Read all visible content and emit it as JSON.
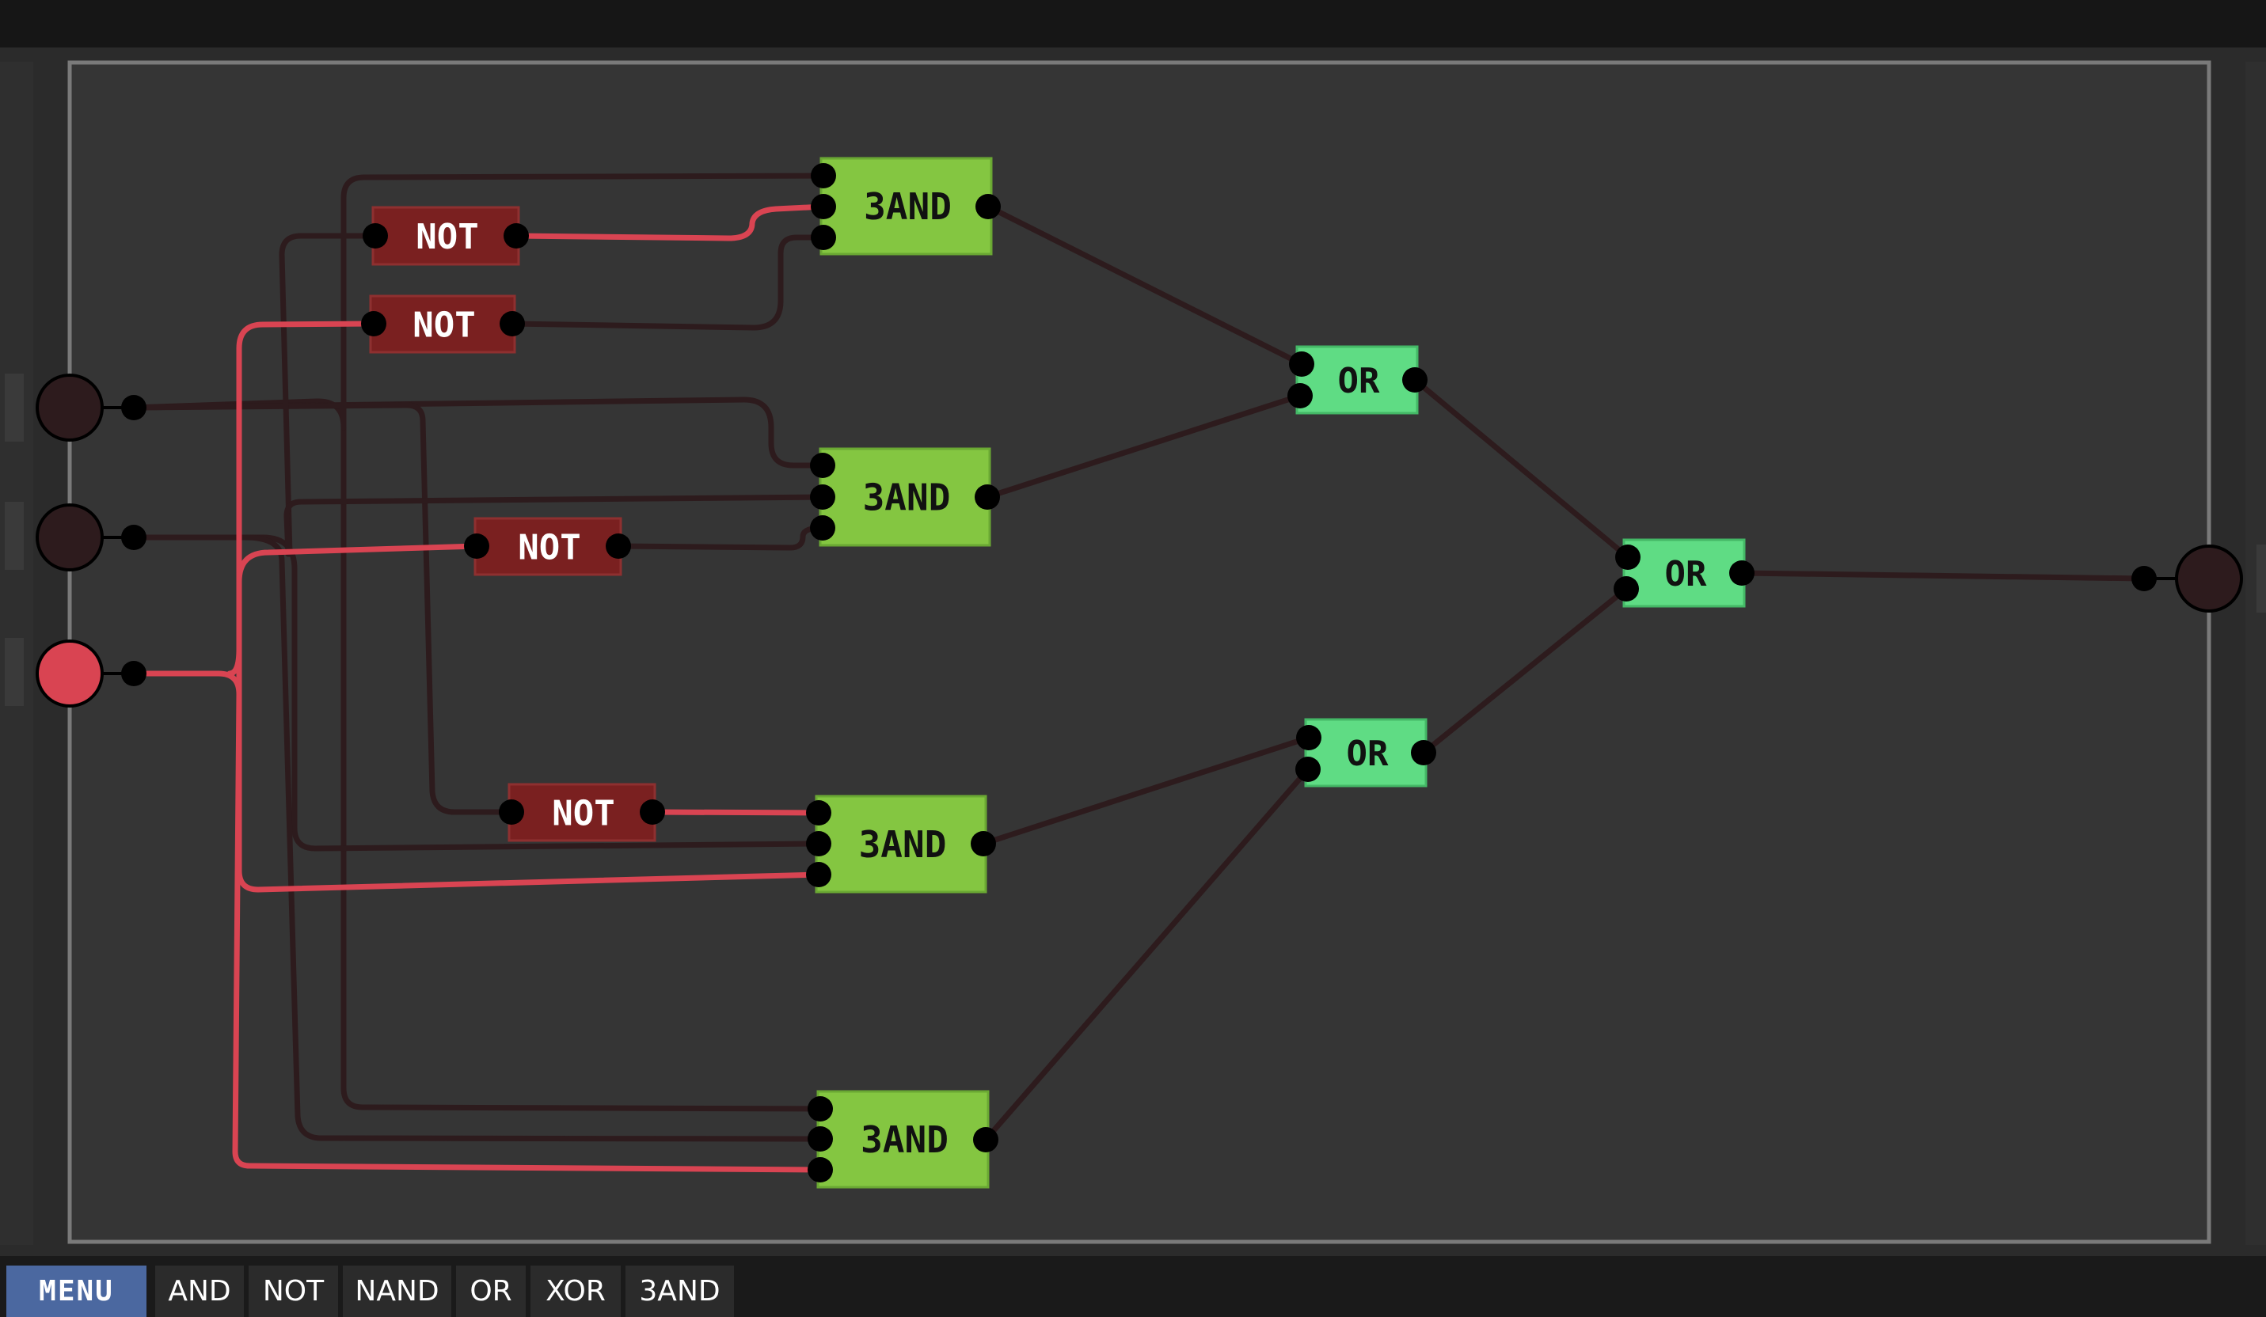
{
  "colors": {
    "background": "#2b2b2b",
    "canvas": "#353535",
    "canvas_border": "#7a7a7a",
    "wire_off": "#2d1b1d",
    "wire_on": "#d94452",
    "and3_fill": "#84c641",
    "or_fill": "#5fdc84",
    "not_fill": "#7a2020",
    "input_off": "#2d1b1d",
    "input_on": "#d94452",
    "menu_button": "#4b68a0"
  },
  "inputs": [
    {
      "id": "in1",
      "state": "off"
    },
    {
      "id": "in2",
      "state": "off"
    },
    {
      "id": "in3",
      "state": "on"
    }
  ],
  "outputs": [
    {
      "id": "out1",
      "state": "off"
    }
  ],
  "gates": {
    "not1": {
      "type": "NOT",
      "label": "NOT"
    },
    "not2": {
      "type": "NOT",
      "label": "NOT"
    },
    "not3": {
      "type": "NOT",
      "label": "NOT"
    },
    "not4": {
      "type": "NOT",
      "label": "NOT"
    },
    "and1": {
      "type": "3AND",
      "label": "3AND"
    },
    "and2": {
      "type": "3AND",
      "label": "3AND"
    },
    "and3": {
      "type": "3AND",
      "label": "3AND"
    },
    "and4": {
      "type": "3AND",
      "label": "3AND"
    },
    "or1": {
      "type": "OR",
      "label": "OR"
    },
    "or2": {
      "type": "OR",
      "label": "OR"
    },
    "or3": {
      "type": "OR",
      "label": "OR"
    }
  },
  "toolbar": {
    "menu_label": "MENU",
    "items": [
      "AND",
      "NOT",
      "NAND",
      "OR",
      "XOR",
      "3AND"
    ]
  }
}
